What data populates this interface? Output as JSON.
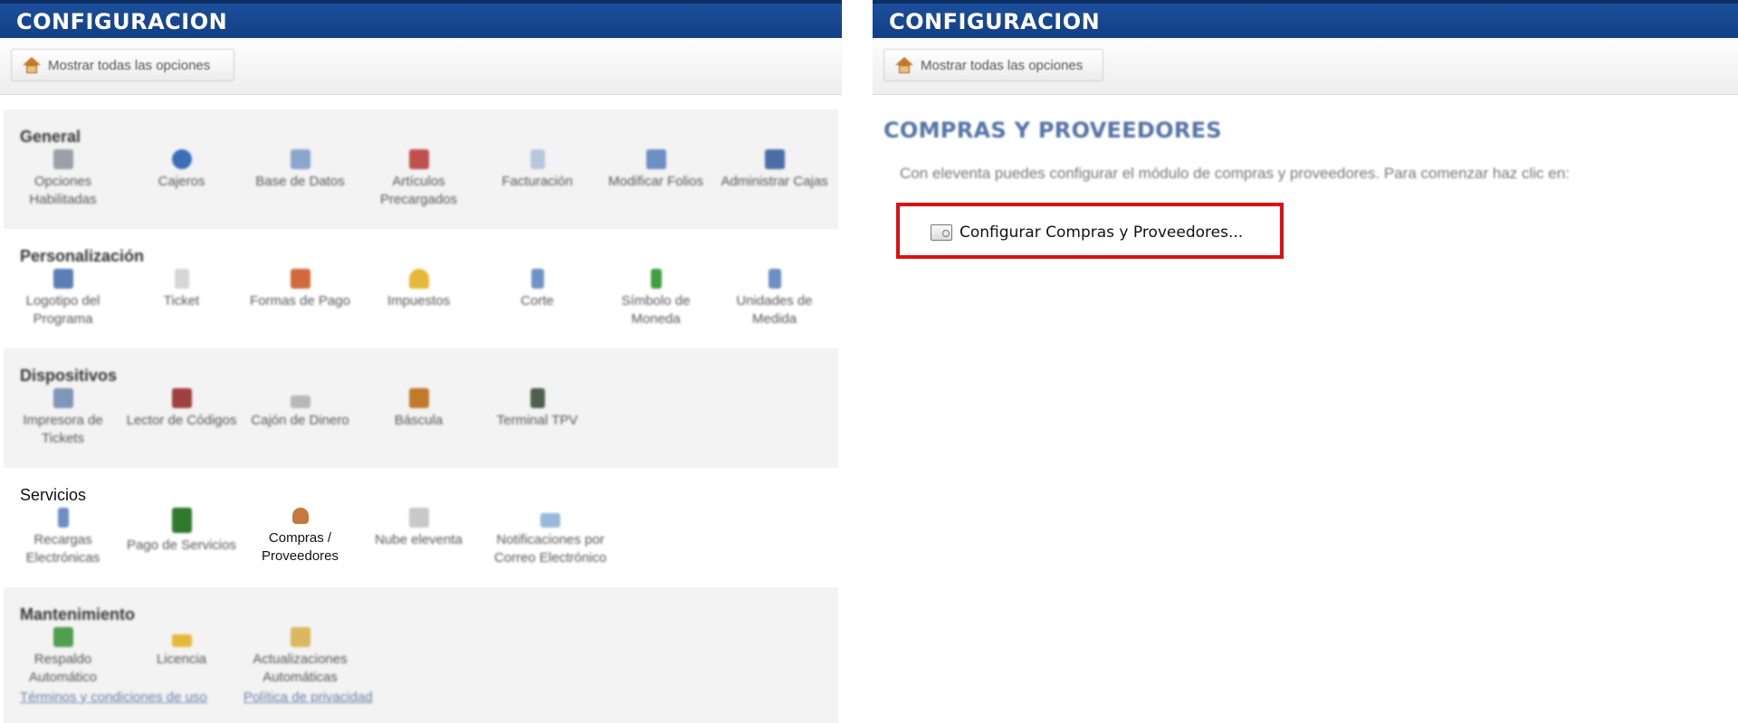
{
  "left_panel": {
    "header_title": "CONFIGURACION",
    "show_all_label": "Mostrar todas las opciones",
    "sections": [
      {
        "title": "General",
        "items": [
          {
            "label": "Opciones Habilitadas",
            "icon": "gear-icon",
            "color": "#9aa0a8"
          },
          {
            "label": "Cajeros",
            "icon": "user-icon",
            "color": "#3a6fb8"
          },
          {
            "label": "Base de Datos",
            "icon": "database-icon",
            "color": "#8aa6cc"
          },
          {
            "label": "Artículos Precargados",
            "icon": "box-icon",
            "color": "#c0504d"
          },
          {
            "label": "Facturación",
            "icon": "invoice-icon",
            "color": "#b8c8dc"
          },
          {
            "label": "Modificar Folios",
            "icon": "calendar-icon",
            "color": "#6d8fc4"
          },
          {
            "label": "Administrar Cajas",
            "icon": "register-icon",
            "color": "#4a6fa8"
          }
        ]
      },
      {
        "title": "Personalización",
        "items": [
          {
            "label": "Logotipo del Programa",
            "icon": "image-icon",
            "color": "#5b7fb5"
          },
          {
            "label": "Ticket",
            "icon": "ticket-icon",
            "color": "#d6d6d6"
          },
          {
            "label": "Formas de Pago",
            "icon": "payment-icon",
            "color": "#d06a3c"
          },
          {
            "label": "Impuestos",
            "icon": "tax-icon",
            "color": "#e6b83a"
          },
          {
            "label": "Corte",
            "icon": "cut-icon",
            "color": "#6f93c8"
          },
          {
            "label": "Símbolo de Moneda",
            "icon": "currency-icon",
            "color": "#3f9f3f"
          },
          {
            "label": "Unidades de Medida",
            "icon": "measure-icon",
            "color": "#6d8fc4"
          }
        ]
      },
      {
        "title": "Dispositivos",
        "items": [
          {
            "label": "Impresora de Tickets",
            "icon": "printer-icon",
            "color": "#7f96b8"
          },
          {
            "label": "Lector de Códigos",
            "icon": "scanner-icon",
            "color": "#a04040"
          },
          {
            "label": "Cajón de Dinero",
            "icon": "cash-drawer-icon",
            "color": "#b8b8b8"
          },
          {
            "label": "Báscula",
            "icon": "scale-icon",
            "color": "#c07a2a"
          },
          {
            "label": "Terminal TPV",
            "icon": "terminal-icon",
            "color": "#4f5f4f"
          }
        ]
      },
      {
        "title": "Servicios",
        "items": [
          {
            "label": "Recargas Electrónicas",
            "icon": "phone-icon",
            "color": "#6d8fc4"
          },
          {
            "label": "Pago de Servicios",
            "icon": "services-icon",
            "color": "#2f7a2f"
          },
          {
            "label": "Compras / Proveedores",
            "icon": "purchases-icon",
            "color": "#c47a3a"
          },
          {
            "label": "Nube eleventa",
            "icon": "cloud-icon",
            "color": "#c8c8c8"
          },
          {
            "label": "Notificaciones por Correo Electrónico",
            "icon": "mail-icon",
            "color": "#9ab8dc"
          }
        ]
      },
      {
        "title": "Mantenimiento",
        "items": [
          {
            "label": "Respaldo Automático",
            "icon": "backup-icon",
            "color": "#4f9f4f"
          },
          {
            "label": "Licencia",
            "icon": "key-icon",
            "color": "#e6b83a"
          },
          {
            "label": "Actualizaciones Automáticas",
            "icon": "update-icon",
            "color": "#d9b860"
          }
        ]
      }
    ],
    "footer_links": [
      "Términos y condiciones de uso",
      "Política de privacidad"
    ]
  },
  "right_panel": {
    "header_title": "CONFIGURACION",
    "show_all_label": "Mostrar todas las opciones",
    "section_title": "COMPRAS Y PROVEEDORES",
    "description": "Con eleventa puedes configurar el módulo de compras y proveedores. Para comenzar haz clic en:",
    "config_button_label": "Configurar Compras y Proveedores...",
    "highlight_color": "#e10f0f"
  }
}
